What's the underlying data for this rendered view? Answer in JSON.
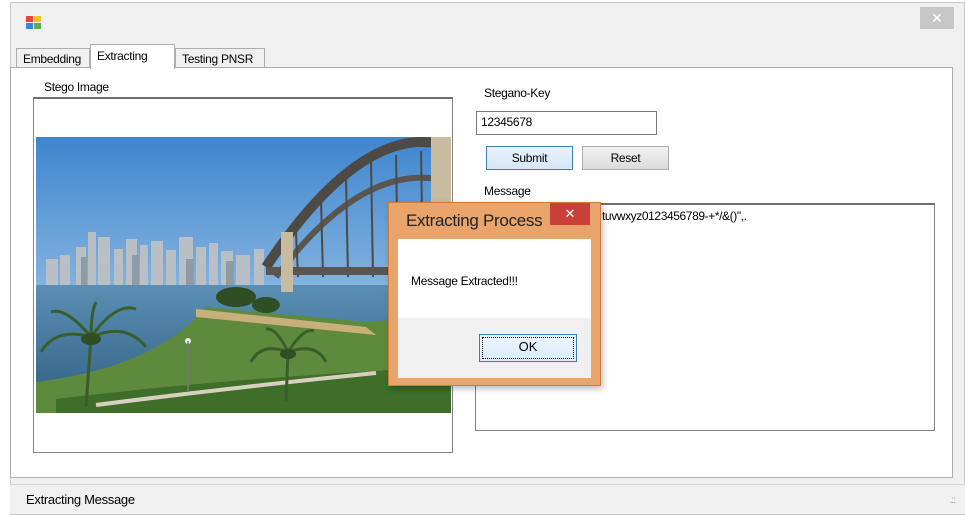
{
  "window": {
    "close_glyph": "✕"
  },
  "tabs": [
    {
      "label": "Embedding",
      "active": false
    },
    {
      "label": "Extracting",
      "active": true
    },
    {
      "label": "Testing PNSR",
      "active": false
    }
  ],
  "left": {
    "stego_image_label": "Stego Image"
  },
  "right": {
    "stegano_key_label": "Stegano-Key",
    "stegano_key_value": "12345678",
    "submit_label": "Submit",
    "reset_label": "Reset",
    "message_label": "Message",
    "message_value": "tuvwxyz0123456789-+*/&()\",."
  },
  "status": {
    "text": "Extracting Message",
    "grip": ".::"
  },
  "dialog": {
    "title": "Extracting Process",
    "close_glyph": "✕",
    "message": "Message Extracted!!!",
    "ok_label": "OK"
  },
  "colors": {
    "dialog_frame": "#e8a46a",
    "dialog_close": "#c9403a",
    "focus_blue": "#3c7fb1"
  },
  "icons": [
    "app-icon",
    "close-icon",
    "resize-grip-icon"
  ]
}
